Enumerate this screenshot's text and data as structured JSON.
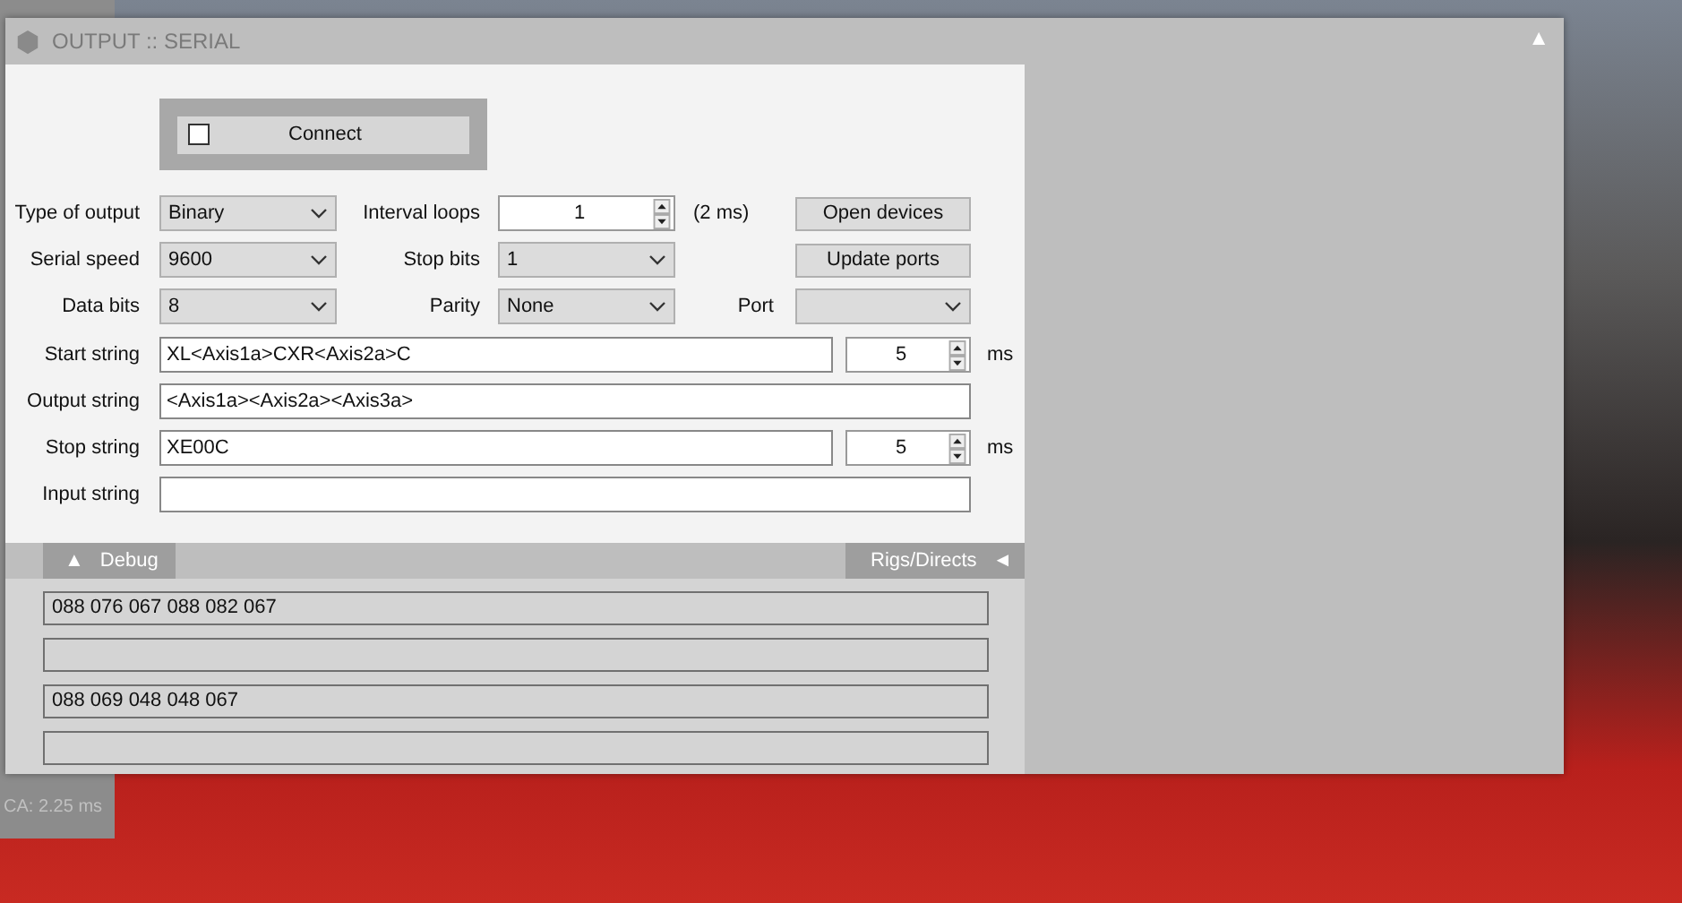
{
  "window": {
    "title": "OUTPUT :: SERIAL",
    "collapse": "▲"
  },
  "connect": {
    "label": "Connect",
    "checked": false
  },
  "grid_rows": [
    {
      "label": "Type of output",
      "field": {
        "kind": "dropdown",
        "value": "Binary"
      },
      "label_2": "Interval loops",
      "field_2": {
        "kind": "spinner",
        "value": "1"
      },
      "note": "(2 ms)",
      "button": "Open devices"
    },
    {
      "label": "Serial speed",
      "field": {
        "kind": "dropdown",
        "value": "9600"
      },
      "label_2": "Stop bits",
      "field_2": {
        "kind": "dropdown",
        "value": "1"
      },
      "button": "Update ports"
    },
    {
      "label": "Data bits",
      "field": {
        "kind": "dropdown",
        "value": "8"
      },
      "label_2": "Parity",
      "field_2": {
        "kind": "dropdown",
        "value": "None"
      },
      "label_3": "Port",
      "field_3": {
        "kind": "dropdown"
      }
    }
  ],
  "string_rows": [
    {
      "label": "Start string",
      "value": "XL<Axis1a>CXR<Axis2a>C",
      "delay": "5",
      "unit": "ms"
    },
    {
      "label": "Output string",
      "value": "<Axis1a><Axis2a><Axis3a>"
    },
    {
      "label": "Stop string",
      "value": "XE00C",
      "delay": "5",
      "unit": "ms"
    },
    {
      "label": "Input string"
    }
  ],
  "tabs": [
    {
      "label": "Debug",
      "arrow": "▲"
    },
    {
      "label": "Rigs/Directs",
      "arrow": "◄"
    }
  ],
  "debug_lines": [
    {
      "kind": "text",
      "text": "088 076 067 088 082 067"
    },
    {
      "kind": "empty"
    },
    {
      "kind": "text",
      "text": "088 069 048 048 067"
    },
    {
      "kind": "empty"
    }
  ],
  "status": {
    "text": "CA: 2.25 ms"
  }
}
